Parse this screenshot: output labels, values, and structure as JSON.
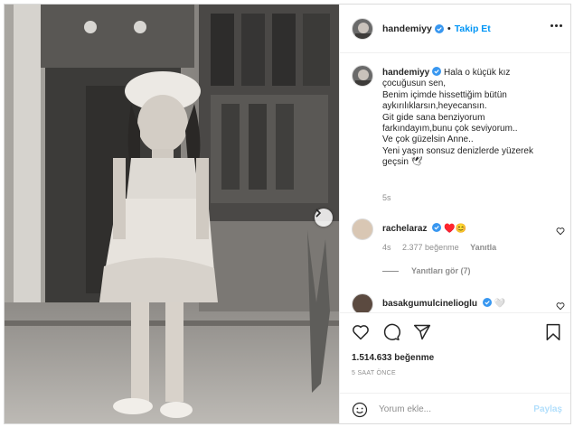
{
  "post": {
    "username": "handemiyy",
    "follow_label": "Takip Et",
    "dot": "•",
    "caption_lines": [
      "Hala o küçük kız",
      "çocuğusun sen,",
      "Benim içimde hissettiğim bütün",
      "aykırılıklarsın,heyecansın.",
      "Git gide sana benziyorum",
      "farkındayım,bunu çok seviyorum..",
      "Ve çok güzelsin Anne..",
      "Yeni yaşın sonsuz denizlerde yüzerek",
      "geçsin 🕊"
    ],
    "caption_time": "5s"
  },
  "comments": [
    {
      "username": "rachelaraz",
      "text": "♥️😊",
      "time": "4s",
      "likes": "2.377 beğenme",
      "reply_label": "Yanıtla",
      "view_replies": "Yanıtları gör (7)"
    },
    {
      "username": "basakgumulcinelioglu",
      "text": "🤍"
    }
  ],
  "actions": {
    "likes": "1.514.633 beğenme",
    "time_ago": "5 SAAT ÖNCE"
  },
  "comment_box": {
    "placeholder": "Yorum ekle...",
    "post_label": "Paylaş"
  },
  "colors": {
    "accent": "#0095f6",
    "verified": "#3897f0",
    "muted": "#8e8e8e"
  },
  "icons": [
    "chevron-right-icon",
    "verified-icon",
    "more-icon",
    "heart-icon",
    "comment-icon",
    "share-icon",
    "save-icon",
    "emoji-icon"
  ]
}
